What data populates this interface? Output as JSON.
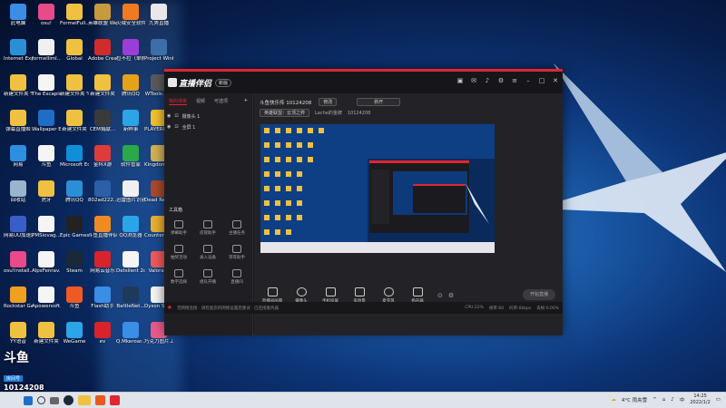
{
  "desktop": {
    "icons": [
      {
        "label": "此电脑",
        "color": "#3a8ee6"
      },
      {
        "label": "osu!",
        "color": "#e84a8a"
      },
      {
        "label": "FormelFull...",
        "color": "#f0c040"
      },
      {
        "label": "英雄联盟 WeGame版",
        "color": "#c79a3c"
      },
      {
        "label": "火绒安全软件",
        "color": "#f07a22"
      },
      {
        "label": "九秀直播",
        "color": "#e8e8e8"
      },
      {
        "label": "Internet Explorer",
        "color": "#2b8fd8"
      },
      {
        "label": "formelliml...",
        "color": "#f0f0f0"
      },
      {
        "label": "Global",
        "color": "#f0c040"
      },
      {
        "label": "Adobe Creati...",
        "color": "#d22b2b"
      },
      {
        "label": "拉不拉（单机游戏修改器）",
        "color": "#9b3dd8"
      },
      {
        "label": "Project Winter",
        "color": "#3c6ea8"
      },
      {
        "label": "新建文件夹 %283%29",
        "color": "#f0c040"
      },
      {
        "label": "The Escapists 2",
        "color": "#f5f5f5"
      },
      {
        "label": "新建文件夹 %283%29",
        "color": "#f0c040"
      },
      {
        "label": "新建文件夹",
        "color": "#f0c040"
      },
      {
        "label": "腾讯QQ",
        "color": "#e3a21a"
      },
      {
        "label": "WTools.exe",
        "color": "#5a5a5a"
      },
      {
        "label": "弹幕直播姬",
        "color": "#f0c040"
      },
      {
        "label": "Wallpaper Engine：...",
        "color": "#1e6ec8"
      },
      {
        "label": "新建文件夹",
        "color": "#f0c040"
      },
      {
        "label": "CEM捐献...",
        "color": "#3a3a3a"
      },
      {
        "label": "新鲜事",
        "color": "#2ba4e8"
      },
      {
        "label": "PLAYERUNK BATTLEG...",
        "color": "#f0c030"
      },
      {
        "label": "网易",
        "color": "#2d8fe0"
      },
      {
        "label": "斗鱼",
        "color": "#f5f5f5"
      },
      {
        "label": "Microsoft Edge",
        "color": "#0f8fd8"
      },
      {
        "label": "金科X游",
        "color": "#e03b3b"
      },
      {
        "label": "软件管家",
        "color": "#2ba84a"
      },
      {
        "label": "Kingdom Two Cro...",
        "color": "#d2b055"
      },
      {
        "label": "回收站",
        "color": "#9ab4cc"
      },
      {
        "label": "虎牙",
        "color": "#f0c040"
      },
      {
        "label": "腾讯QQ",
        "color": "#2b8fd8"
      },
      {
        "label": "802ad222...",
        "color": "#2b5fa8"
      },
      {
        "label": "迅雷图片识别器 epic-bd06",
        "color": "#f0f0f0"
      },
      {
        "label": "Dead Redemption",
        "color": "#a84a2b"
      },
      {
        "label": "网易UU加速器",
        "color": "#3a5ec8"
      },
      {
        "label": "PMSiovag...",
        "color": "#f5f5f5"
      },
      {
        "label": "Epic Games Launcher",
        "color": "#222222"
      },
      {
        "label": "斗鱼直播伴侣",
        "color": "#f08a22"
      },
      {
        "label": "QQ浏览器",
        "color": "#2ba4e8"
      },
      {
        "label": "Counter Global Off",
        "color": "#e8b030"
      },
      {
        "label": "osu!install...",
        "color": "#e84a8a"
      },
      {
        "label": "AlpsFenrav...",
        "color": "#f5f5f5"
      },
      {
        "label": "Steam",
        "color": "#1b2838"
      },
      {
        "label": "网易云音乐",
        "color": "#d8232a"
      },
      {
        "label": "Detsilent 2d...",
        "color": "#f5f5f5"
      },
      {
        "label": "Valorant",
        "color": "#f05a5a"
      },
      {
        "label": "Rockstar Games Launcher",
        "color": "#f0a020"
      },
      {
        "label": "Apowersoft...",
        "color": "#f5f5f5"
      },
      {
        "label": "斗鱼",
        "color": "#f05a22"
      },
      {
        "label": "Flash助手",
        "color": "#3a8ee6"
      },
      {
        "label": "BattleNet...",
        "color": "#1e3a5a"
      },
      {
        "label": "Dyson Sphere...",
        "color": "#f5f5f5"
      },
      {
        "label": "YY语音",
        "color": "#f0c040"
      },
      {
        "label": "新建文件夹",
        "color": "#f0c040"
      },
      {
        "label": "WeGame",
        "color": "#2ba4e8"
      },
      {
        "label": "ev",
        "color": "#d8232a"
      },
      {
        "label": "Q.Mkeroar...",
        "color": "#3a8ee6"
      },
      {
        "label": "巧克力图片工具",
        "color": "#e85a8a"
      }
    ]
  },
  "watermark": {
    "brand": "斗鱼",
    "tag": "房间号",
    "room": "10124208"
  },
  "app": {
    "logo": "直播伴侣",
    "version": "新版",
    "left_tabs": [
      "我的场景",
      "视频",
      "可选项"
    ],
    "add": "+",
    "scenes": [
      "摄像头 1",
      "全屏 1"
    ],
    "tools_title": "工具箱",
    "tools": [
      "弹幕助手",
      "房管助手",
      "主播任务",
      "抽奖活动",
      "录入设备",
      "等等助手",
      "数字选择",
      "组队开播",
      "直播间"
    ],
    "room_title": "斗鱼快乐传 10124208",
    "edit_btn": "修改",
    "category_btn": "新开",
    "sub_labels": [
      "英雄联盟：云顶之弈",
      "Lache的金牌",
      "10124208"
    ],
    "bottom_tools": [
      "直播间画面",
      "摄像头",
      "手机投屏",
      "多场景",
      "麦克风",
      "扬声器"
    ],
    "start_btn": "开始直播",
    "status": "无网络连接 · 请检查您的网络设置后重试 · 已连接服务器",
    "status_right": [
      "CPU:22%",
      "帧率:60",
      "码率:0kbps",
      "丢帧:0.00%"
    ]
  },
  "taskbar": {
    "weather": "4°C 雨夹雪",
    "time": "14:25",
    "date": "2022/1/2",
    "lang": "中"
  }
}
